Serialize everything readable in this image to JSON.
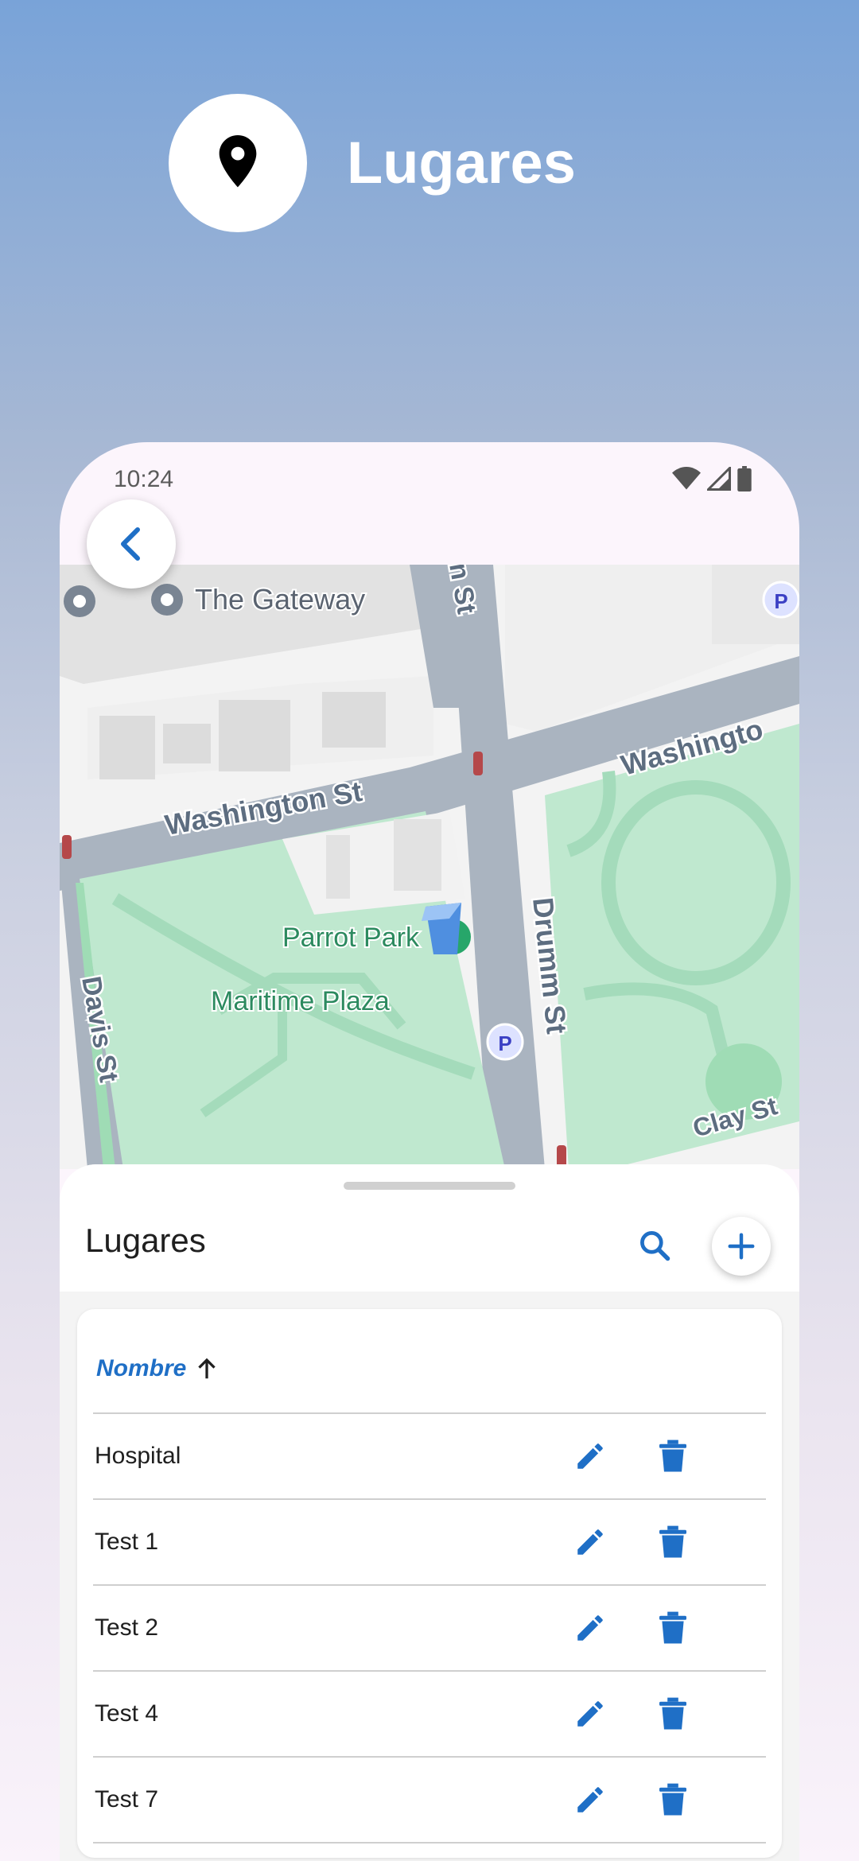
{
  "header": {
    "title": "Lugares",
    "icon": "location-pin-icon"
  },
  "status_bar": {
    "time": "10:24",
    "icons": [
      "wifi-icon",
      "cellular-signal-icon",
      "battery-icon"
    ]
  },
  "map": {
    "labels": {
      "gateway": "The Gateway",
      "washington_left": "Washington St",
      "washington_right": "Washingto",
      "parrot_park": "Parrot Park",
      "maritime_plaza": "Maritime Plaza",
      "davis": "Davis St",
      "drumm": "Drumm St",
      "clay": "Clay St",
      "top_street": "n St",
      "parking": "P"
    }
  },
  "sheet": {
    "title": "Lugares",
    "column_header": "Nombre",
    "sort_direction": "ascending",
    "rows": [
      {
        "name": "Hospital"
      },
      {
        "name": "Test 1"
      },
      {
        "name": "Test 2"
      },
      {
        "name": "Test 4"
      },
      {
        "name": "Test 7"
      }
    ]
  },
  "colors": {
    "accent": "#1f6fc6",
    "map_park": "#bfe8cf",
    "map_road": "#aab4c0"
  }
}
